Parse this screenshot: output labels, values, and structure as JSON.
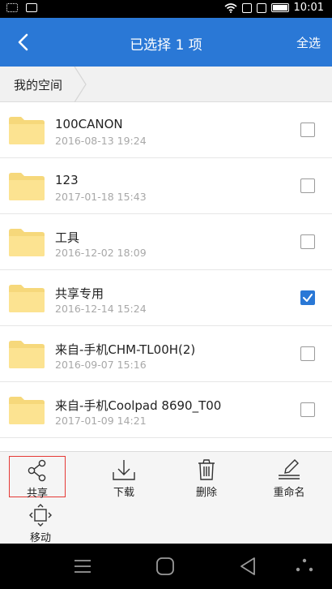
{
  "status_bar": {
    "time": "10:01"
  },
  "header": {
    "title": "已选择 1 项",
    "select_all": "全选"
  },
  "breadcrumb": {
    "root": "我的空间"
  },
  "files": [
    {
      "name": "100CANON",
      "date": "2016-08-13 19:24",
      "checked": false
    },
    {
      "name": "123",
      "date": "2017-01-18 15:43",
      "checked": false
    },
    {
      "name": "工具",
      "date": "2016-12-02 18:09",
      "checked": false
    },
    {
      "name": "共享专用",
      "date": "2016-12-14 15:24",
      "checked": true
    },
    {
      "name": "来自-手机CHM-TL00H(2)",
      "date": "2016-09-07 15:16",
      "checked": false
    },
    {
      "name": "来自-手机Coolpad 8690_T00",
      "date": "2017-01-09 14:21",
      "checked": false
    }
  ],
  "actions": {
    "share": "共享",
    "download": "下载",
    "delete": "删除",
    "rename": "重命名",
    "move": "移动"
  },
  "colors": {
    "accent": "#2a78d6",
    "folder": "#fce391",
    "highlight_border": "#e53935"
  }
}
